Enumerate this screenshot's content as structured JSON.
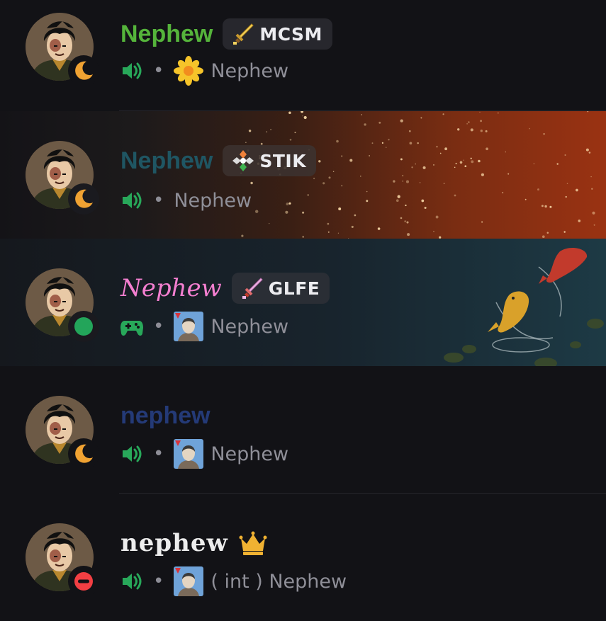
{
  "members": [
    {
      "name": "Nephew",
      "name_color": "#55b43b",
      "status": "idle",
      "tag": {
        "label": "MCSM",
        "icon": "golden-sword-icon"
      },
      "activity_icon": "voice-speaker-icon",
      "status_emoji": "sunflower-icon",
      "status_text": "Nephew"
    },
    {
      "name": "Nephew",
      "name_color": "#1f5663",
      "status": "idle",
      "tag": {
        "label": "STIK",
        "icon": "cross-gem-icon"
      },
      "activity_icon": "voice-speaker-icon",
      "status_text": "Nephew",
      "banner": "ember-sparkles"
    },
    {
      "name": "Nephew",
      "name_color": "#f47fd0",
      "status": "online",
      "tag": {
        "label": "GLFE",
        "icon": "pink-sword-icon"
      },
      "activity_icon": "game-controller-icon",
      "status_emoji": "character-portrait-icon",
      "status_text": "Nephew",
      "banner": "koi-pond"
    },
    {
      "name": "nephew",
      "name_color": "#243a77",
      "status": "idle",
      "activity_icon": "voice-speaker-icon",
      "status_emoji": "character-portrait-icon",
      "status_text": "Nephew"
    },
    {
      "name": "nephew",
      "name_color": "#ededed",
      "status": "do-not-disturb",
      "owner_icon": "crown-icon",
      "activity_icon": "voice-speaker-icon",
      "status_emoji": "character-portrait-icon",
      "status_text": "( int ) Nephew"
    }
  ]
}
